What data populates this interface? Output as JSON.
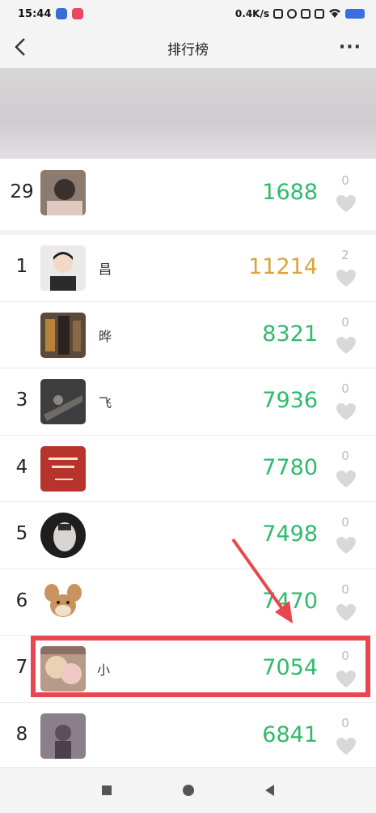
{
  "status_bar": {
    "time": "15:44",
    "network_speed": "0.4K/s"
  },
  "navbar": {
    "back_icon": "chevron-left-icon",
    "title": "排行榜",
    "more_label": "···"
  },
  "self_entry": {
    "rank": "29",
    "name": "",
    "score": "1688",
    "likes": "0",
    "avatar_color": "#7a6f6a"
  },
  "ranking": [
    {
      "rank": "1",
      "name": "昌",
      "score": "11214",
      "likes": "2",
      "gold": true,
      "avatar_color": "#e8e6e4"
    },
    {
      "rank": "",
      "name": "晔",
      "score": "8321",
      "likes": "0",
      "gold": false,
      "avatar_color": "#6b5a46"
    },
    {
      "rank": "3",
      "name": "飞",
      "score": "7936",
      "likes": "0",
      "gold": false,
      "avatar_color": "#4a4a4c"
    },
    {
      "rank": "4",
      "name": "",
      "score": "7780",
      "likes": "0",
      "gold": false,
      "avatar_color": "#b6342c"
    },
    {
      "rank": "5",
      "name": "",
      "score": "7498",
      "likes": "0",
      "gold": false,
      "avatar_color": "#2a2a2a"
    },
    {
      "rank": "6",
      "name": "",
      "score": "7470",
      "likes": "0",
      "gold": false,
      "avatar_color": "#c9935f"
    },
    {
      "rank": "7",
      "name": "小",
      "score": "7054",
      "likes": "0",
      "gold": false,
      "avatar_color": "#b07f76"
    },
    {
      "rank": "8",
      "name": "",
      "score": "6841",
      "likes": "0",
      "gold": false,
      "avatar_color": "#7d6a72"
    }
  ],
  "colors": {
    "score_green": "#2fba6b",
    "score_gold": "#d8a638",
    "annotation_red": "#e8474f"
  }
}
